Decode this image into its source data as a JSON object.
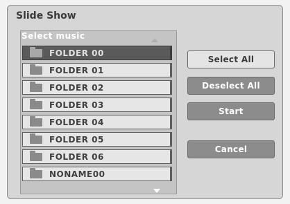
{
  "dialog": {
    "title": "Slide Show",
    "list_header": "Select music",
    "folders": [
      "FOLDER 00",
      "FOLDER 01",
      "FOLDER 02",
      "FOLDER 03",
      "FOLDER 04",
      "FOLDER 05",
      "FOLDER 06",
      "NONAME00"
    ],
    "selected_index": 0
  },
  "buttons": {
    "select_all": "Select All",
    "deselect_all": "Deselect All",
    "start": "Start",
    "cancel": "Cancel"
  },
  "icons": {
    "folder": "folder-icon",
    "scroll_up": "scroll-up-icon",
    "scroll_down": "scroll-down-icon"
  },
  "colors": {
    "selected_row": "#5a5a5a",
    "dark_button": "#8c8c8c",
    "light_button": "#e4e4e4"
  }
}
